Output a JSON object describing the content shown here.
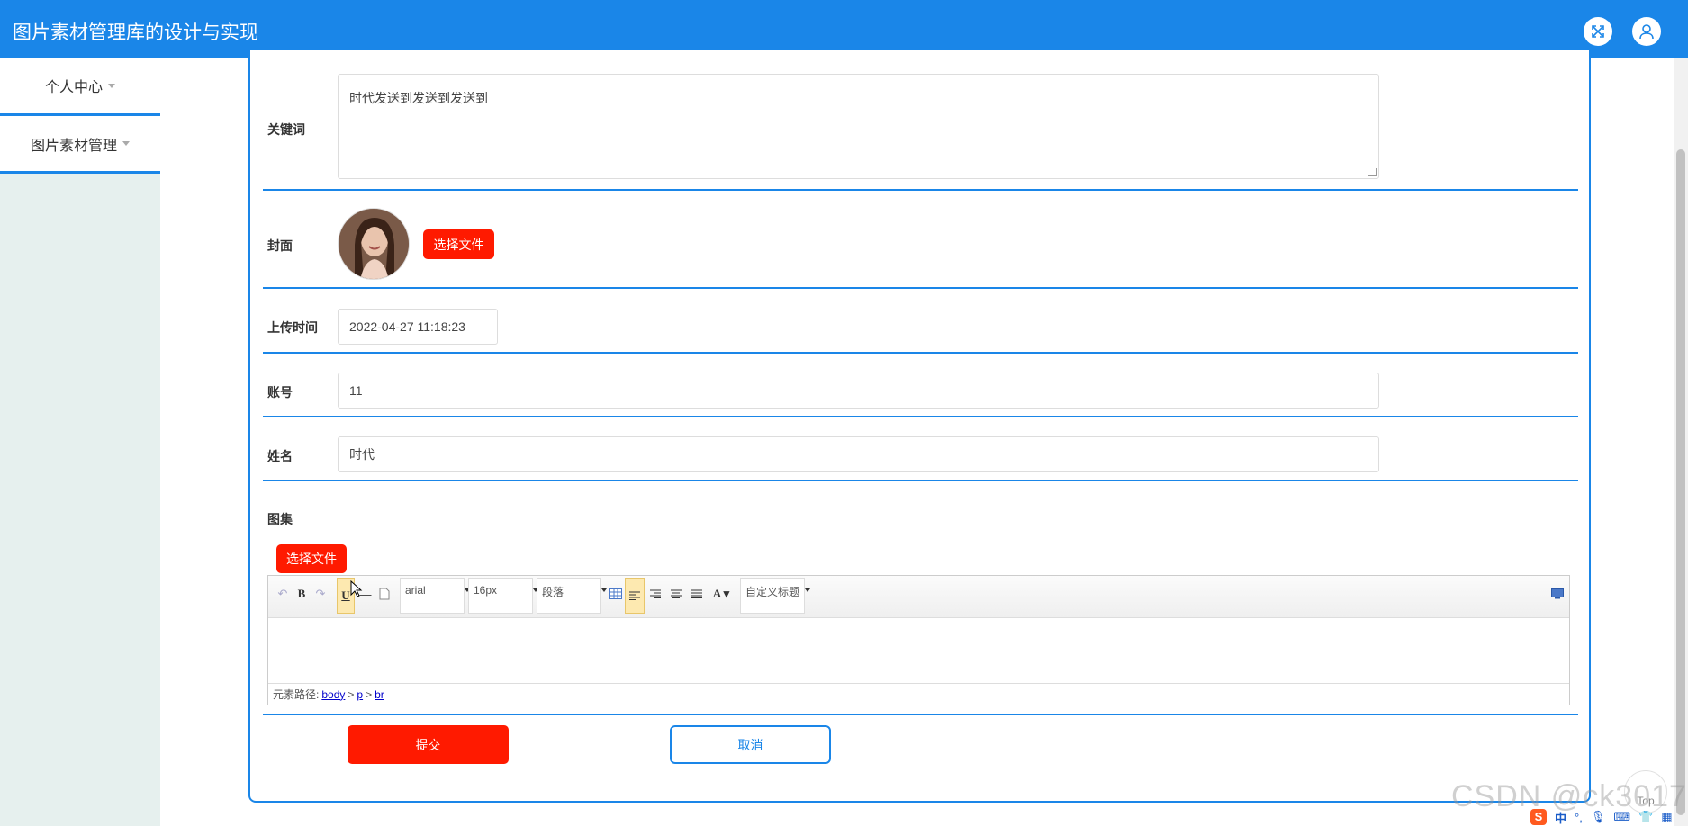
{
  "header": {
    "title": "图片素材管理库的设计与实现",
    "bg_color": "#1a86e8",
    "icons": [
      "fullscreen-icon",
      "user-icon"
    ]
  },
  "sidebar": {
    "items": [
      {
        "label": "个人中心"
      },
      {
        "label": "图片素材管理"
      }
    ]
  },
  "form": {
    "keywords": {
      "label": "关键词",
      "value": "时代发送到发送到发送到"
    },
    "cover": {
      "label": "封面",
      "button": "选择文件"
    },
    "upload_time": {
      "label": "上传时间",
      "value": "2022-04-27 11:18:23"
    },
    "account": {
      "label": "账号",
      "value": "11"
    },
    "name": {
      "label": "姓名",
      "value": "时代"
    },
    "gallery": {
      "label": "图集",
      "button": "选择文件"
    },
    "submit_label": "提交",
    "cancel_label": "取消"
  },
  "editor": {
    "font_family": "arial",
    "font_size": "16px",
    "paragraph": "段落",
    "custom_title": "自定义标题",
    "path_label": "元素路径:",
    "path": [
      "body",
      "p",
      "br"
    ],
    "path_sep": ">"
  },
  "watermark": "CSDN @ck3017",
  "top_button": "Top",
  "ime": {
    "label": "中"
  },
  "colors": {
    "accent": "#1a86e8",
    "danger": "#ff1a00",
    "sidebar_bg": "#e6f0ee"
  }
}
